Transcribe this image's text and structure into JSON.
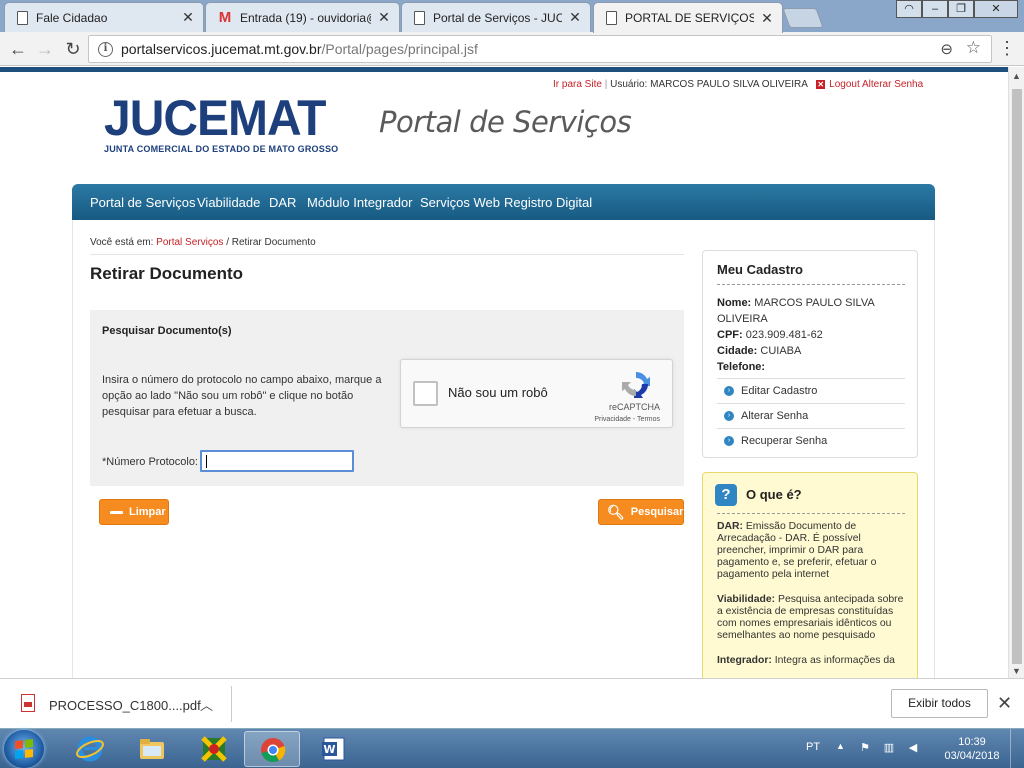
{
  "browser": {
    "tabs": [
      {
        "title": "Fale Cidadao",
        "favicon": "document-icon",
        "active": false
      },
      {
        "title": "Entrada (19) - ouvidoria@",
        "favicon": "gmail-icon",
        "badge": "19",
        "active": false
      },
      {
        "title": "Portal de Serviços - JUCE",
        "favicon": "document-icon",
        "active": false
      },
      {
        "title": "PORTAL DE SERVIÇOS",
        "favicon": "document-icon",
        "active": true
      }
    ],
    "url_host": "portalservicos.jucemat.mt.gov.br",
    "url_path": "/Portal/pages/principal.jsf"
  },
  "header": {
    "ir_para_site": "Ir para Site",
    "usuario": "Usuário: MARCOS PAULO SILVA OLIVEIRA",
    "logout": "Logout",
    "alterar_senha": "Alterar Senha",
    "logo_text": "JUCEMAT",
    "logo_subtitle": "JUNTA COMERCIAL DO ESTADO DE MATO GROSSO",
    "portal_title": "Portal de Serviços"
  },
  "nav": [
    "Portal de Serviços",
    "Viabilidade",
    "DAR",
    "Módulo Integrador",
    "Serviços Web",
    "Registro Digital"
  ],
  "breadcrumb": {
    "prefix": "Você está em:",
    "link": "Portal Serviços",
    "current": "/ Retirar Documento"
  },
  "page_title": "Retirar Documento",
  "search": {
    "heading": "Pesquisar Documento(s)",
    "instructions": "Insira o número do protocolo no campo abaixo, marque a opção ao lado \"Não sou um robô\" e clique no botão pesquisar para efetuar a busca.",
    "captcha_label": "Não sou um robô",
    "captcha_brand": "reCAPTCHA",
    "captcha_links": "Privacidade - Termos",
    "protocol_label": "*Número Protocolo:",
    "protocol_value": "",
    "clear_button": "Limpar",
    "search_button": "Pesquisar"
  },
  "meu_cadastro": {
    "heading": "Meu Cadastro",
    "nome_label": "Nome:",
    "nome": "MARCOS PAULO SILVA OLIVEIRA",
    "cpf_label": "CPF:",
    "cpf": "023.909.481-62",
    "cidade_label": "Cidade:",
    "cidade": "CUIABA",
    "telefone_label": "Telefone:",
    "telefone": "",
    "links": [
      "Editar Cadastro",
      "Alterar Senha",
      "Recuperar Senha"
    ]
  },
  "o_que_e": {
    "heading": "O que é?",
    "items": [
      {
        "term": "DAR:",
        "text": "Emissão Documento de Arrecadação - DAR. É possível preencher, imprimir o DAR para pagamento e, se preferir, efetuar o pagamento pela internet"
      },
      {
        "term": "Viabilidade:",
        "text": "Pesquisa antecipada sobre a existência de empresas constituídas com nomes empresariais idênticos ou semelhantes ao nome pesquisado"
      },
      {
        "term": "Integrador:",
        "text": "Integra as informações da"
      }
    ]
  },
  "download": {
    "filename": "PROCESSO_C1800....pdf",
    "show_all": "Exibir todos"
  },
  "taskbar": {
    "language": "PT",
    "time": "10:39",
    "date": "03/04/2018"
  },
  "colors": {
    "nav_blue": "#1f6a92",
    "brand_blue": "#1d3f7c",
    "orange": "#f68b1f",
    "red_link": "#c62127",
    "help_yellow": "#fffad1"
  }
}
